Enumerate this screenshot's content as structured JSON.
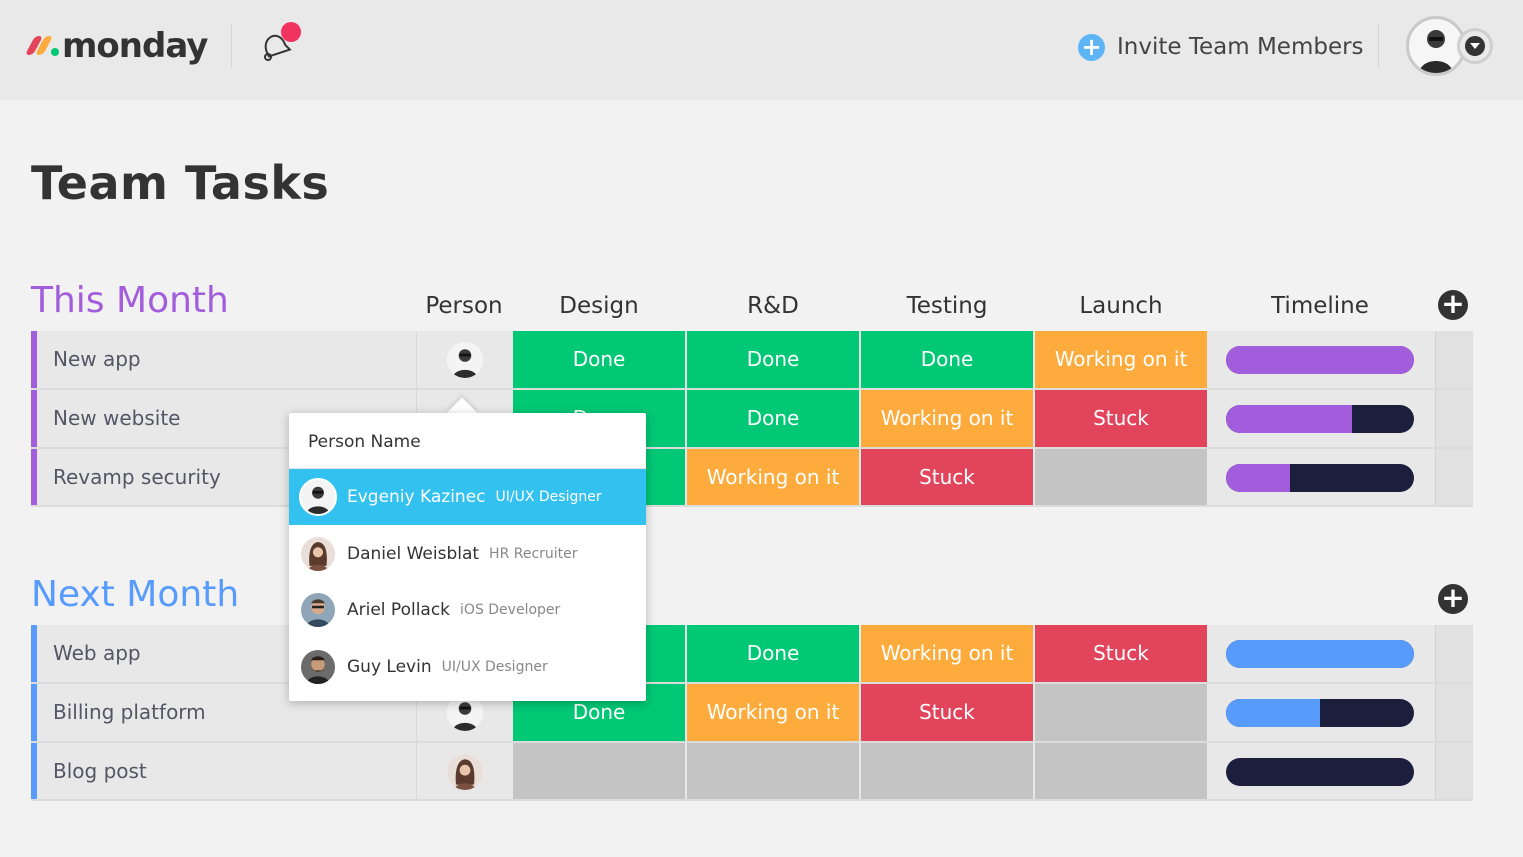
{
  "header": {
    "logo_text": "monday",
    "invite_label": "Invite Team Members"
  },
  "page": {
    "title": "Team Tasks"
  },
  "columns": [
    "Person",
    "Design",
    "R&D",
    "Testing",
    "Launch",
    "Timeline"
  ],
  "colors": {
    "done": "#00c875",
    "working": "#fdab3d",
    "stuck": "#e2445c",
    "empty": "#c4c4c4",
    "group1": "#a25ddc",
    "group2": "#579bfc",
    "timeline_dark": "#1c1f3b"
  },
  "groups": [
    {
      "title": "This Month",
      "rows": [
        {
          "name": "New app",
          "design": "Done",
          "rnd": "Done",
          "testing": "Done",
          "launch": "Working on it",
          "timeline_progress": 1.0
        },
        {
          "name": "New website",
          "design": "Done",
          "rnd": "Done",
          "testing": "Working on it",
          "launch": "Stuck",
          "timeline_progress": 0.67
        },
        {
          "name": "Revamp security",
          "design": "",
          "rnd": "Working on it",
          "testing": "Stuck",
          "launch": "",
          "timeline_progress": 0.34
        }
      ]
    },
    {
      "title": "Next Month",
      "rows": [
        {
          "name": "Web app",
          "design": "",
          "rnd": "Done",
          "testing": "Working on it",
          "launch": "Stuck",
          "timeline_progress": 1.0
        },
        {
          "name": "Billing platform",
          "design": "Done",
          "rnd": "Working on it",
          "testing": "Stuck",
          "launch": "",
          "timeline_progress": 0.5
        },
        {
          "name": "Blog post",
          "design": "",
          "rnd": "",
          "testing": "",
          "launch": "",
          "timeline_progress": 0.0
        }
      ]
    }
  ],
  "person_dropdown": {
    "header": "Person Name",
    "people": [
      {
        "name": "Evgeniy Kazinec",
        "role": "UI/UX Designer",
        "selected": true
      },
      {
        "name": "Daniel Weisblat",
        "role": "HR Recruiter",
        "selected": false
      },
      {
        "name": "Ariel Pollack",
        "role": "iOS Developer",
        "selected": false
      },
      {
        "name": "Guy Levin",
        "role": "UI/UX Designer",
        "selected": false
      }
    ]
  }
}
